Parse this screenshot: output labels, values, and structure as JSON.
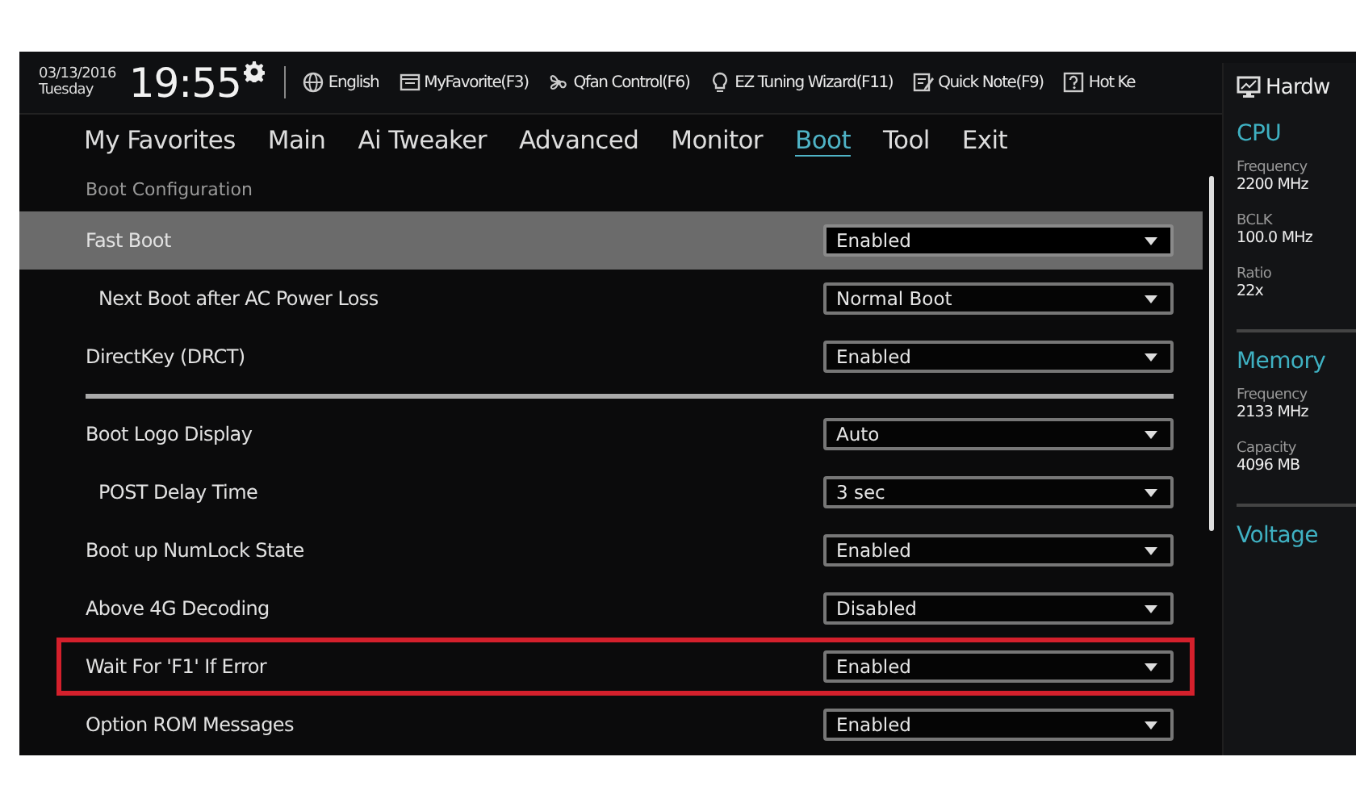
{
  "header": {
    "date": "03/13/2016",
    "day": "Tuesday",
    "time": "19:55",
    "items": [
      {
        "label": "English"
      },
      {
        "label": "MyFavorite(F3)"
      },
      {
        "label": "Qfan Control(F6)"
      },
      {
        "label": "EZ Tuning Wizard(F11)"
      },
      {
        "label": "Quick Note(F9)"
      },
      {
        "label": "Hot Ke"
      }
    ]
  },
  "tabs": [
    {
      "label": "My Favorites",
      "selected": false
    },
    {
      "label": "Main",
      "selected": false
    },
    {
      "label": "Ai Tweaker",
      "selected": false
    },
    {
      "label": "Advanced",
      "selected": false
    },
    {
      "label": "Monitor",
      "selected": false
    },
    {
      "label": "Boot",
      "selected": true
    },
    {
      "label": "Tool",
      "selected": false
    },
    {
      "label": "Exit",
      "selected": false
    }
  ],
  "section_title": "Boot Configuration",
  "groups": [
    {
      "rows": [
        {
          "label": "Fast Boot",
          "value": "Enabled",
          "selected": true,
          "highlighted": false,
          "children": [
            {
              "label": "Next Boot after AC Power Loss",
              "value": "Normal Boot",
              "selected": false,
              "highlighted": false
            }
          ]
        },
        {
          "label": "DirectKey (DRCT)",
          "value": "Enabled",
          "selected": false,
          "highlighted": false
        }
      ]
    },
    {
      "rows": [
        {
          "label": "Boot Logo Display",
          "value": "Auto",
          "selected": false,
          "highlighted": false,
          "children": [
            {
              "label": "POST Delay Time",
              "value": "3 sec",
              "selected": false,
              "highlighted": false
            }
          ]
        },
        {
          "label": "Boot up NumLock State",
          "value": "Enabled",
          "selected": false,
          "highlighted": false
        },
        {
          "label": "Above 4G Decoding",
          "value": "Disabled",
          "selected": false,
          "highlighted": false
        },
        {
          "label": "Wait For 'F1' If Error",
          "value": "Enabled",
          "selected": false,
          "highlighted": true
        },
        {
          "label": "Option ROM Messages",
          "value": "Enabled",
          "selected": false,
          "highlighted": false
        }
      ]
    }
  ],
  "sidebar": {
    "title": "Hardw",
    "sections": [
      {
        "title": "CPU",
        "fields": [
          {
            "label": "Frequency",
            "value": "2200 MHz"
          },
          {
            "label": "BCLK",
            "value": "100.0 MHz"
          },
          {
            "label": "Ratio",
            "value": "22x"
          }
        ]
      },
      {
        "title": "Memory",
        "fields": [
          {
            "label": "Frequency",
            "value": "2133 MHz"
          },
          {
            "label": "Capacity",
            "value": "4096 MB"
          }
        ]
      },
      {
        "title": "Voltage"
      }
    ]
  }
}
